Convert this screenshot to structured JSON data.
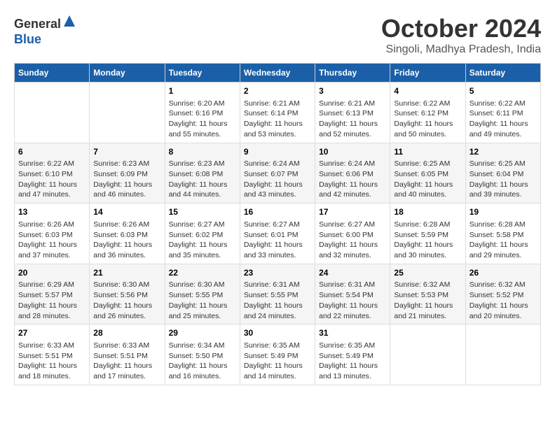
{
  "header": {
    "logo_line1": "General",
    "logo_line2": "Blue",
    "month": "October 2024",
    "location": "Singoli, Madhya Pradesh, India"
  },
  "days_of_week": [
    "Sunday",
    "Monday",
    "Tuesday",
    "Wednesday",
    "Thursday",
    "Friday",
    "Saturday"
  ],
  "weeks": [
    [
      {
        "day": "",
        "info": ""
      },
      {
        "day": "",
        "info": ""
      },
      {
        "day": "1",
        "info": "Sunrise: 6:20 AM\nSunset: 6:16 PM\nDaylight: 11 hours and 55 minutes."
      },
      {
        "day": "2",
        "info": "Sunrise: 6:21 AM\nSunset: 6:14 PM\nDaylight: 11 hours and 53 minutes."
      },
      {
        "day": "3",
        "info": "Sunrise: 6:21 AM\nSunset: 6:13 PM\nDaylight: 11 hours and 52 minutes."
      },
      {
        "day": "4",
        "info": "Sunrise: 6:22 AM\nSunset: 6:12 PM\nDaylight: 11 hours and 50 minutes."
      },
      {
        "day": "5",
        "info": "Sunrise: 6:22 AM\nSunset: 6:11 PM\nDaylight: 11 hours and 49 minutes."
      }
    ],
    [
      {
        "day": "6",
        "info": "Sunrise: 6:22 AM\nSunset: 6:10 PM\nDaylight: 11 hours and 47 minutes."
      },
      {
        "day": "7",
        "info": "Sunrise: 6:23 AM\nSunset: 6:09 PM\nDaylight: 11 hours and 46 minutes."
      },
      {
        "day": "8",
        "info": "Sunrise: 6:23 AM\nSunset: 6:08 PM\nDaylight: 11 hours and 44 minutes."
      },
      {
        "day": "9",
        "info": "Sunrise: 6:24 AM\nSunset: 6:07 PM\nDaylight: 11 hours and 43 minutes."
      },
      {
        "day": "10",
        "info": "Sunrise: 6:24 AM\nSunset: 6:06 PM\nDaylight: 11 hours and 42 minutes."
      },
      {
        "day": "11",
        "info": "Sunrise: 6:25 AM\nSunset: 6:05 PM\nDaylight: 11 hours and 40 minutes."
      },
      {
        "day": "12",
        "info": "Sunrise: 6:25 AM\nSunset: 6:04 PM\nDaylight: 11 hours and 39 minutes."
      }
    ],
    [
      {
        "day": "13",
        "info": "Sunrise: 6:26 AM\nSunset: 6:03 PM\nDaylight: 11 hours and 37 minutes."
      },
      {
        "day": "14",
        "info": "Sunrise: 6:26 AM\nSunset: 6:03 PM\nDaylight: 11 hours and 36 minutes."
      },
      {
        "day": "15",
        "info": "Sunrise: 6:27 AM\nSunset: 6:02 PM\nDaylight: 11 hours and 35 minutes."
      },
      {
        "day": "16",
        "info": "Sunrise: 6:27 AM\nSunset: 6:01 PM\nDaylight: 11 hours and 33 minutes."
      },
      {
        "day": "17",
        "info": "Sunrise: 6:27 AM\nSunset: 6:00 PM\nDaylight: 11 hours and 32 minutes."
      },
      {
        "day": "18",
        "info": "Sunrise: 6:28 AM\nSunset: 5:59 PM\nDaylight: 11 hours and 30 minutes."
      },
      {
        "day": "19",
        "info": "Sunrise: 6:28 AM\nSunset: 5:58 PM\nDaylight: 11 hours and 29 minutes."
      }
    ],
    [
      {
        "day": "20",
        "info": "Sunrise: 6:29 AM\nSunset: 5:57 PM\nDaylight: 11 hours and 28 minutes."
      },
      {
        "day": "21",
        "info": "Sunrise: 6:30 AM\nSunset: 5:56 PM\nDaylight: 11 hours and 26 minutes."
      },
      {
        "day": "22",
        "info": "Sunrise: 6:30 AM\nSunset: 5:55 PM\nDaylight: 11 hours and 25 minutes."
      },
      {
        "day": "23",
        "info": "Sunrise: 6:31 AM\nSunset: 5:55 PM\nDaylight: 11 hours and 24 minutes."
      },
      {
        "day": "24",
        "info": "Sunrise: 6:31 AM\nSunset: 5:54 PM\nDaylight: 11 hours and 22 minutes."
      },
      {
        "day": "25",
        "info": "Sunrise: 6:32 AM\nSunset: 5:53 PM\nDaylight: 11 hours and 21 minutes."
      },
      {
        "day": "26",
        "info": "Sunrise: 6:32 AM\nSunset: 5:52 PM\nDaylight: 11 hours and 20 minutes."
      }
    ],
    [
      {
        "day": "27",
        "info": "Sunrise: 6:33 AM\nSunset: 5:51 PM\nDaylight: 11 hours and 18 minutes."
      },
      {
        "day": "28",
        "info": "Sunrise: 6:33 AM\nSunset: 5:51 PM\nDaylight: 11 hours and 17 minutes."
      },
      {
        "day": "29",
        "info": "Sunrise: 6:34 AM\nSunset: 5:50 PM\nDaylight: 11 hours and 16 minutes."
      },
      {
        "day": "30",
        "info": "Sunrise: 6:35 AM\nSunset: 5:49 PM\nDaylight: 11 hours and 14 minutes."
      },
      {
        "day": "31",
        "info": "Sunrise: 6:35 AM\nSunset: 5:49 PM\nDaylight: 11 hours and 13 minutes."
      },
      {
        "day": "",
        "info": ""
      },
      {
        "day": "",
        "info": ""
      }
    ]
  ]
}
